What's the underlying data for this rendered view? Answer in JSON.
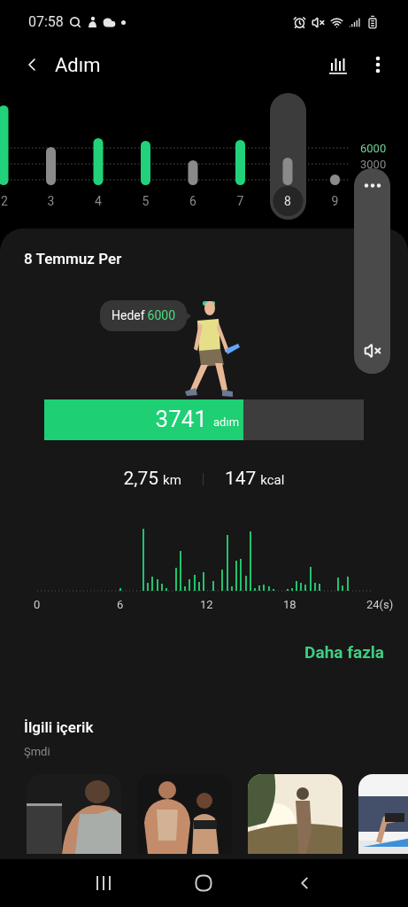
{
  "status_bar": {
    "time": "07:58"
  },
  "header": {
    "title": "Adım"
  },
  "daily_chart": {
    "goal_label": "6000",
    "mid_label": "3000",
    "days": [
      {
        "label": "2",
        "selected": false,
        "goal_met": true
      },
      {
        "label": "3",
        "selected": false,
        "goal_met": false
      },
      {
        "label": "4",
        "selected": false,
        "goal_met": true
      },
      {
        "label": "5",
        "selected": false,
        "goal_met": true
      },
      {
        "label": "6",
        "selected": false,
        "goal_met": false
      },
      {
        "label": "7",
        "selected": false,
        "goal_met": true
      },
      {
        "label": "8",
        "selected": true,
        "goal_met": false
      },
      {
        "label": "9",
        "selected": false,
        "goal_met": false
      }
    ]
  },
  "card": {
    "date": "8 Temmuz Per",
    "goal_bubble": {
      "label": "Hedef",
      "value": "6000"
    },
    "progress": {
      "level": 0.6235,
      "value": "3741",
      "unit": "adım"
    },
    "stats": [
      {
        "value": "2,75",
        "unit": "km"
      },
      {
        "value": "147",
        "unit": "kcal"
      }
    ],
    "hourly_axis_labels": [
      "0",
      "6",
      "12",
      "18",
      "24(s)"
    ],
    "more_link": "Daha fazla",
    "related": {
      "title": "İlgili içerik",
      "subtitle": "Şmdi"
    }
  },
  "volume_panel": {
    "muted": true
  }
}
